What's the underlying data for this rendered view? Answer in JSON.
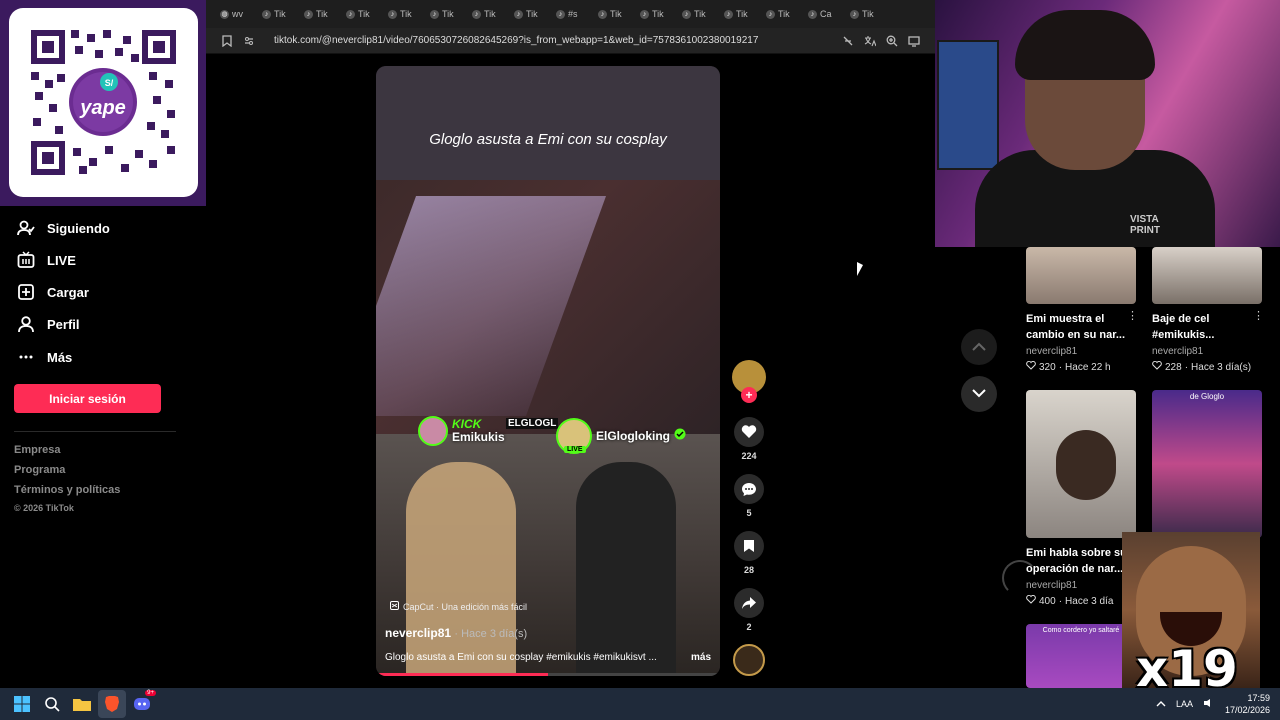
{
  "browser": {
    "tabs": [
      {
        "label": "wv",
        "icon": "globe-icon"
      },
      {
        "label": "Tik",
        "icon": "tiktok-icon"
      },
      {
        "label": "Tik",
        "icon": "tiktok-icon"
      },
      {
        "label": "Tik",
        "icon": "tiktok-icon"
      },
      {
        "label": "Tik",
        "icon": "tiktok-icon"
      },
      {
        "label": "Tik",
        "icon": "tiktok-icon"
      },
      {
        "label": "Tik",
        "icon": "tiktok-icon"
      },
      {
        "label": "Tik",
        "icon": "tiktok-icon"
      },
      {
        "label": "#s",
        "icon": "tiktok-icon"
      },
      {
        "label": "Tik",
        "icon": "tiktok-icon"
      },
      {
        "label": "Tik",
        "icon": "tiktok-icon"
      },
      {
        "label": "Tik",
        "icon": "tiktok-icon"
      },
      {
        "label": "Tik",
        "icon": "tiktok-icon"
      },
      {
        "label": "Tik",
        "icon": "tiktok-icon"
      },
      {
        "label": "Ca",
        "icon": "tiktok-icon"
      },
      {
        "label": "Tik",
        "icon": "tiktok-icon"
      }
    ],
    "url": "tiktok.com/@neverclip81/video/7606530726082645269?is_from_webapp=1&web_id=7578361002380019217"
  },
  "qr": {
    "brand": "yape",
    "currency": "S/"
  },
  "sidebar": {
    "items": [
      {
        "label": "Siguiendo",
        "icon": "following-icon"
      },
      {
        "label": "LIVE",
        "icon": "live-icon"
      },
      {
        "label": "Cargar",
        "icon": "upload-icon"
      },
      {
        "label": "Perfil",
        "icon": "profile-icon"
      },
      {
        "label": "Más",
        "icon": "more-icon"
      }
    ],
    "login_label": "Iniciar sesión",
    "footer_links": [
      "Empresa",
      "Programa",
      "Términos y políticas"
    ],
    "copyright": "© 2026 TikTok"
  },
  "video": {
    "caption": "Gloglo asusta a Emi con su cosplay",
    "kick_label": "KICK",
    "streamer_left": "Emikukis",
    "streamer_center": "ELGLOGL",
    "streamer_right": "ElGlogloking",
    "live_label": "LIVE",
    "capcut": "CapCut · Una edición más fácil",
    "author": "neverclip81",
    "time": "· Hace 3 día(s)",
    "description": "Gloglo asusta a Emi con su cosplay #emikukis #emikukisvt ...",
    "more": "más",
    "progress": 0.5
  },
  "actions": {
    "likes": "224",
    "comments": "5",
    "saves": "28",
    "shares": "2"
  },
  "webcam": {
    "shirt_text": "VISTA PRINT"
  },
  "recommendations": [
    {
      "title": "Emi muestra el cambio en su nar...",
      "author": "neverclip81",
      "likes": "320",
      "time": "Hace 22 h"
    },
    {
      "title": "Baje de cel #emikukis...",
      "author": "neverclip81",
      "likes": "228",
      "time": "Hace 3 día(s)"
    },
    {
      "title": "Emi habla sobre su operación de nar...",
      "author": "neverclip81",
      "likes": "400",
      "time": "Hace 3 día"
    },
    {
      "title": "",
      "author": "",
      "likes": "",
      "time": ""
    }
  ],
  "thumb_captions": [
    "de Gloglo",
    "Como cordero yo saltaré"
  ],
  "overlay_text": "x19",
  "taskbar": {
    "lang": "LAA",
    "time": "17:59",
    "date": "17/02/2026",
    "discord_badge": "9+"
  }
}
